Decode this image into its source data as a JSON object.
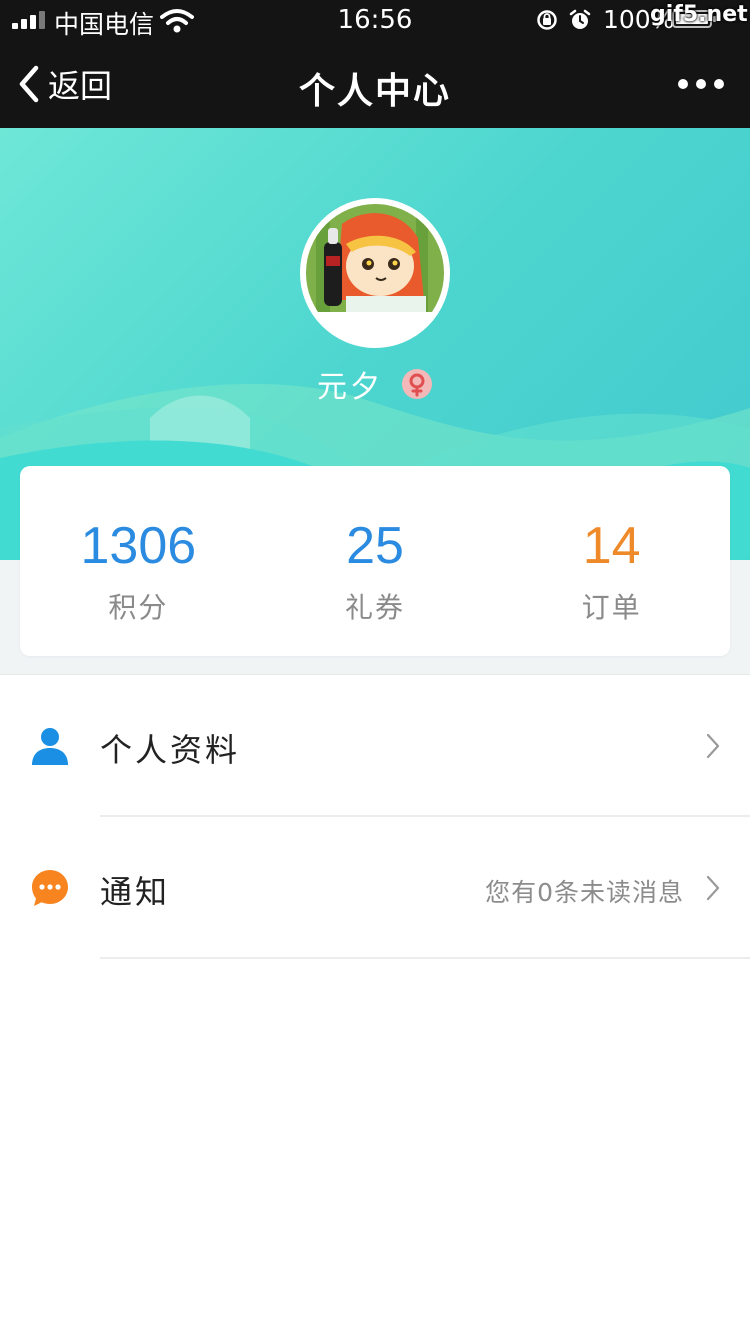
{
  "status_bar": {
    "carrier": "中国电信",
    "time": "16:56",
    "battery": "100%",
    "battery_level": 1.0,
    "icons": [
      "signal-icon",
      "wifi-icon",
      "rotation-lock-icon",
      "alarm-icon",
      "battery-icon"
    ],
    "watermark": "gif5.net"
  },
  "nav": {
    "back_label": "返回",
    "title": "个人中心",
    "more_icon": "more-dots-icon"
  },
  "profile": {
    "username": "元夕",
    "gender_icon": "female-icon"
  },
  "stats": [
    {
      "value": "1306",
      "label": "积分",
      "color": "#2b8be0"
    },
    {
      "value": "25",
      "label": "礼券",
      "color": "#2b8be0"
    },
    {
      "value": "14",
      "label": "订单",
      "color": "#ef8a2a"
    }
  ],
  "menu": [
    {
      "label": "个人资料",
      "extra": "",
      "icon": "user-icon",
      "icon_color": "#1a8fe3"
    },
    {
      "label": "通知",
      "extra": "您有0条未读消息",
      "icon": "chat-bubble-icon",
      "icon_color": "#f7841f"
    }
  ],
  "colors": {
    "header_gradient_start": "#6ee7d7",
    "header_gradient_end": "#3fc6cf",
    "bar_background": "#141414"
  }
}
